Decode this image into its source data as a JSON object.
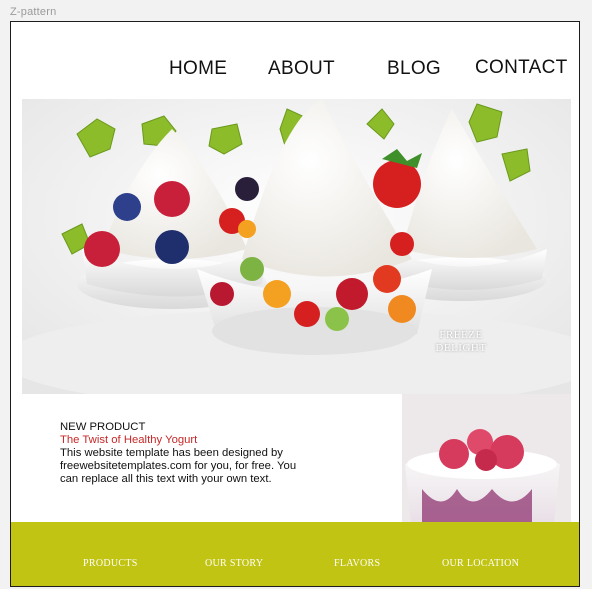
{
  "canvas": {
    "label": "Z-pattern"
  },
  "nav": {
    "items": [
      {
        "label": "HOME"
      },
      {
        "label": "ABOUT"
      },
      {
        "label": "BLOG"
      },
      {
        "label": "CONTACT"
      }
    ]
  },
  "hero": {
    "caption_line1": "FREEZE",
    "caption_line2": "DELIGHT",
    "image": "frozen-yogurt-cups-with-fruit"
  },
  "product": {
    "heading": "NEW PRODUCT",
    "subtitle": "The Twist of Healthy Yogurt",
    "description": "This website template has been designed by freewebsitetemplates.com for you, for free. You can replace all this text with your own text.",
    "image": "raspberry-yogurt-glass"
  },
  "footer": {
    "items": [
      {
        "label": "PRODUCTS"
      },
      {
        "label": "OUR STORY"
      },
      {
        "label": "FLAVORS"
      },
      {
        "label": "OUR LOCATION"
      }
    ]
  },
  "colors": {
    "footer_bg": "#c2c414",
    "accent_red": "#c62828",
    "frame_border": "#1d1d1d"
  }
}
